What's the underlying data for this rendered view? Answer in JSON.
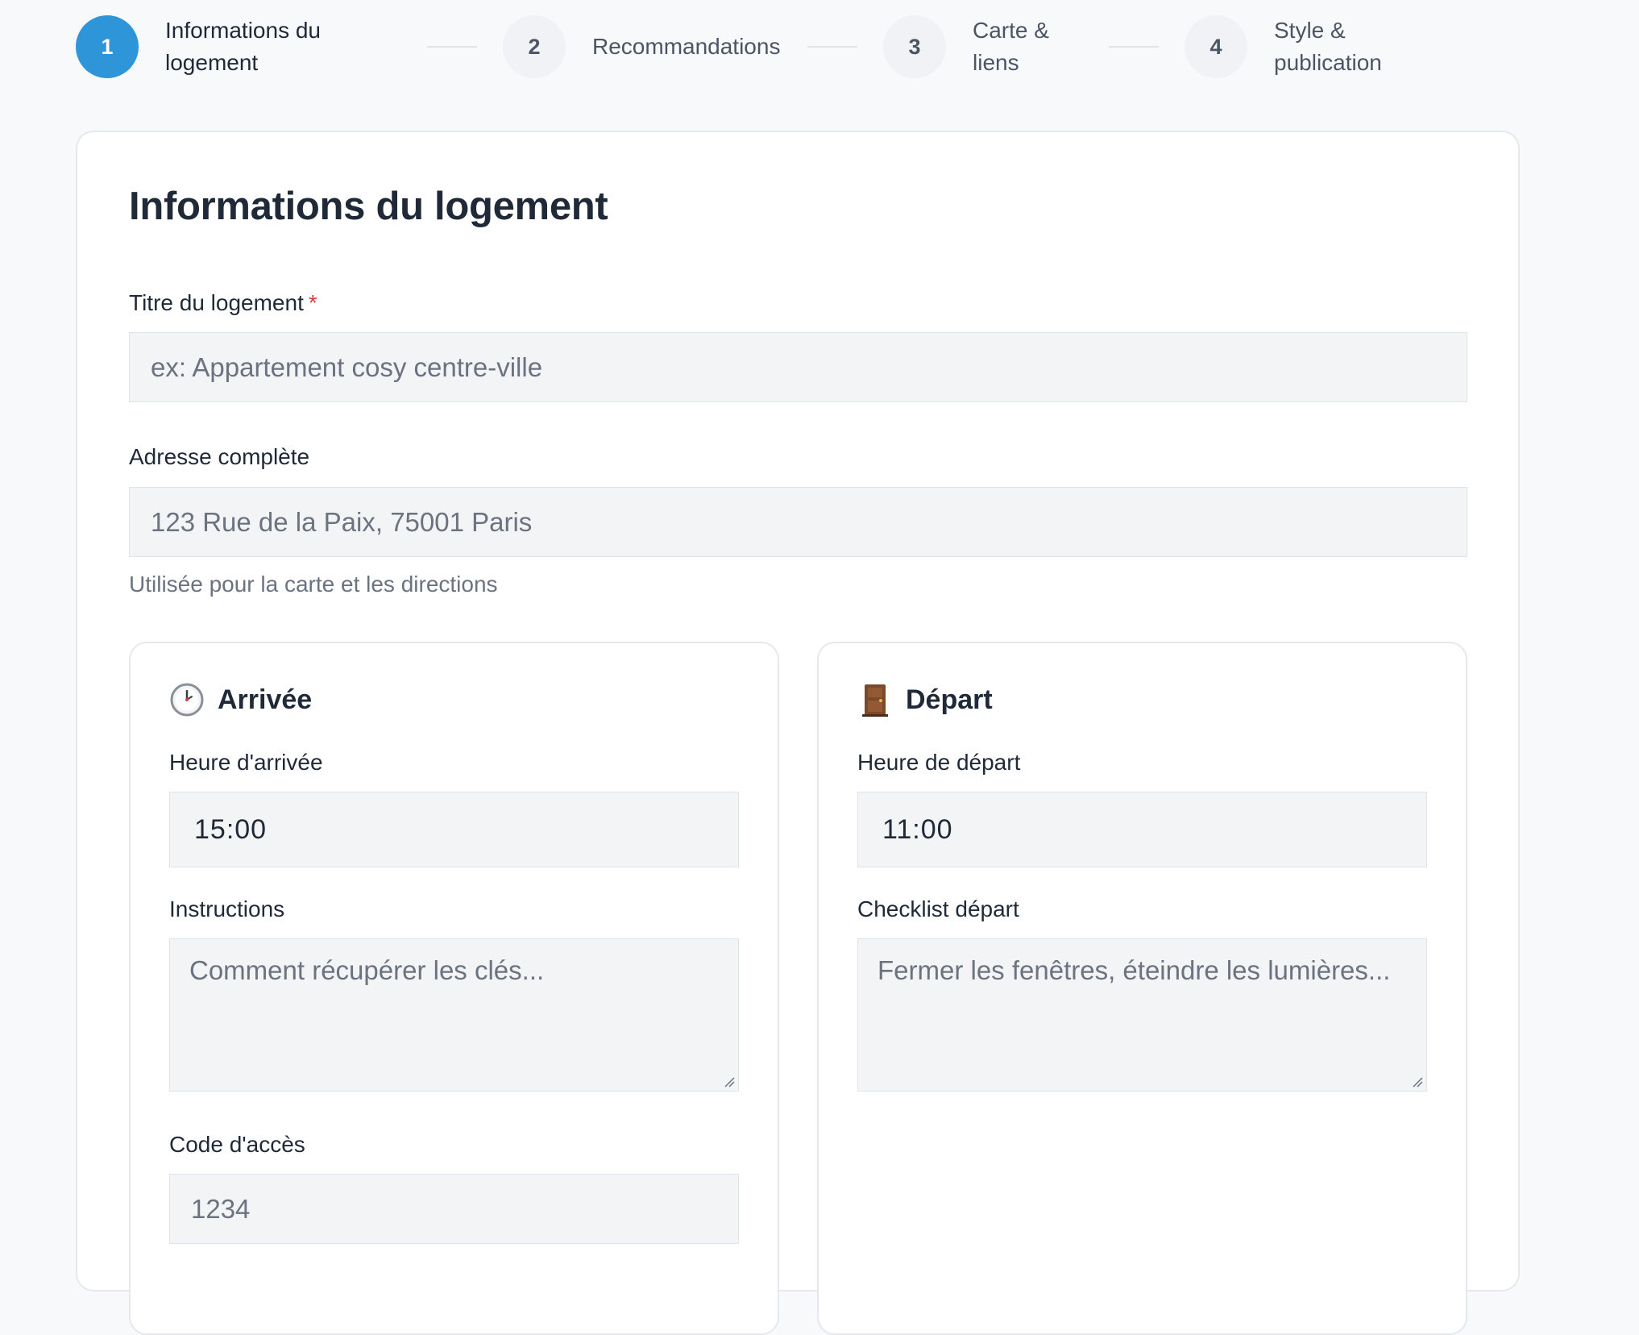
{
  "stepper": {
    "steps": [
      {
        "number": "1",
        "label_line1": "Informations du",
        "label_line2": "logement",
        "active": true
      },
      {
        "number": "2",
        "label_line1": "Recommandations",
        "label_line2": "",
        "active": false
      },
      {
        "number": "3",
        "label_line1": "Carte &",
        "label_line2": "liens",
        "active": false
      },
      {
        "number": "4",
        "label_line1": "Style &",
        "label_line2": "publication",
        "active": false
      }
    ]
  },
  "form": {
    "title": "Informations du logement",
    "titre": {
      "label": "Titre du logement",
      "required_mark": "*",
      "placeholder": "ex: Appartement cosy centre-ville",
      "value": ""
    },
    "adresse": {
      "label": "Adresse complète",
      "placeholder": "123 Rue de la Paix, 75001 Paris",
      "value": "",
      "hint": "Utilisée pour la carte et les directions"
    },
    "arrivee": {
      "title": "Arrivée",
      "icon": "clock-icon",
      "time_label": "Heure d'arrivée",
      "time_value": "15:00",
      "instructions_label": "Instructions",
      "instructions_placeholder": "Comment récupérer les clés...",
      "code_label": "Code d'accès",
      "code_placeholder": "1234"
    },
    "depart": {
      "title": "Départ",
      "icon": "door-icon",
      "time_label": "Heure de départ",
      "time_value": "11:00",
      "checklist_label": "Checklist départ",
      "checklist_placeholder": "Fermer les fenêtres, éteindre les lumières..."
    }
  },
  "colors": {
    "accent": "#2f95d9",
    "required": "#e03b3b",
    "input_bg": "#f3f4f6",
    "page_bg": "#f8f9fb"
  }
}
